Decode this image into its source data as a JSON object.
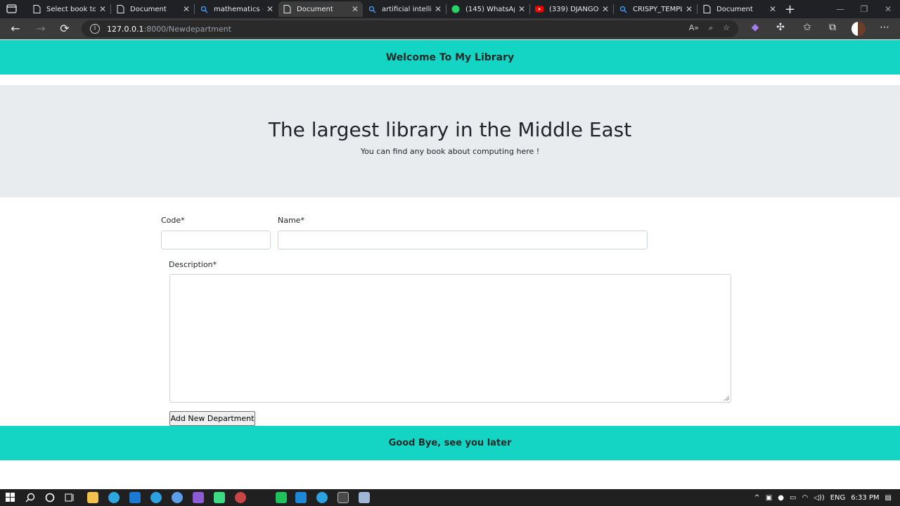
{
  "browser": {
    "tabs": [
      {
        "title": "Select book to",
        "favicon": "document-icon",
        "active": false
      },
      {
        "title": "Document",
        "favicon": "document-icon",
        "active": false
      },
      {
        "title": "mathematics - ",
        "favicon": "search-icon",
        "active": false
      },
      {
        "title": "Document",
        "favicon": "document-icon",
        "active": true
      },
      {
        "title": "artificial intellig",
        "favicon": "search-icon",
        "active": false
      },
      {
        "title": "(145) WhatsAp",
        "favicon": "whatsapp-icon",
        "active": false
      },
      {
        "title": "(339) DJANGO",
        "favicon": "youtube-icon",
        "active": false
      },
      {
        "title": "CRISPY_TEMPL",
        "favicon": "search-icon",
        "active": false
      },
      {
        "title": "Document",
        "favicon": "document-icon",
        "active": false
      }
    ],
    "address": {
      "host": "127.0.0.1",
      "path": ":8000/Newdepartment"
    }
  },
  "page": {
    "header_title": "Welcome To My Library",
    "hero_title": "The largest library in the Middle East",
    "hero_subtitle": "You can find any book about computing here !",
    "form": {
      "code_label": "Code*",
      "code_value": "",
      "name_label": "Name*",
      "name_value": "",
      "description_label": "Description*",
      "description_value": "",
      "submit_label": "Add New Department"
    },
    "footer_text": "Good Bye, see you later"
  },
  "taskbar": {
    "language": "ENG",
    "time": "6:33 PM"
  },
  "colors": {
    "accent": "#14d5c3",
    "hero_bg": "#e9ecef",
    "chrome_dark": "#202124",
    "chrome_toolbar": "#3b3b3b"
  }
}
